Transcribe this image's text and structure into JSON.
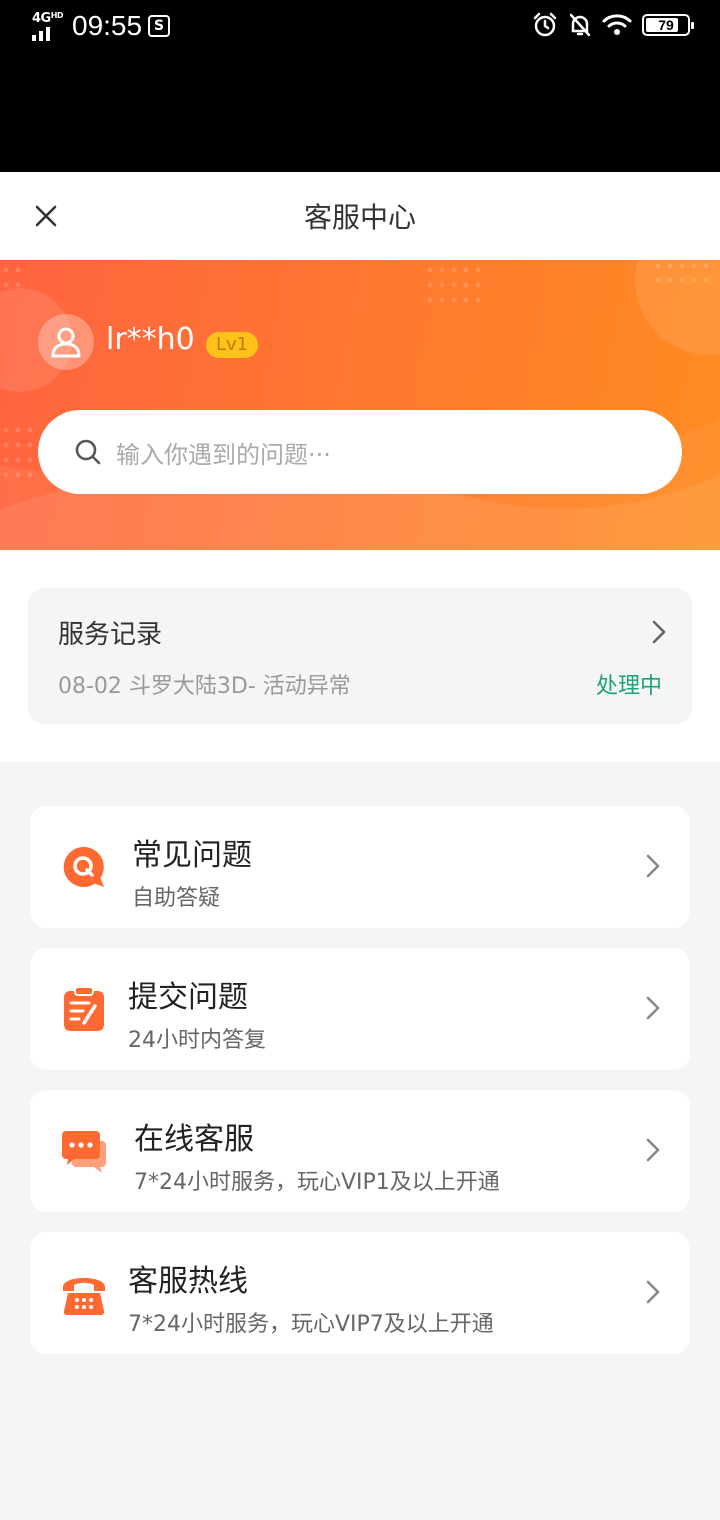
{
  "status_bar": {
    "network": "4G",
    "network_sup": "HD",
    "time": "09:55",
    "app_icon_glyph": "S",
    "battery": "79",
    "battery_level": 0.79
  },
  "nav": {
    "title": "客服中心",
    "close_icon": "close-icon"
  },
  "user": {
    "name": "lr**h0",
    "level": "Lv1"
  },
  "search": {
    "placeholder": "输入你遇到的问题···"
  },
  "record": {
    "title": "服务记录",
    "detail": "08-02 斗罗大陆3D- 活动异常",
    "status": "处理中"
  },
  "menu": [
    {
      "title": "常见问题",
      "subtitle": "自助答疑",
      "icon": "faq-icon"
    },
    {
      "title": "提交问题",
      "subtitle": "24小时内答复",
      "icon": "submit-icon"
    },
    {
      "title": "在线客服",
      "subtitle": "7*24小时服务，玩心VIP1及以上开通",
      "icon": "chat-icon"
    },
    {
      "title": "客服热线",
      "subtitle": "7*24小时服务，玩心VIP7及以上开通",
      "icon": "phone-icon"
    }
  ],
  "colors": {
    "accent": "#ff6a33",
    "status_green": "#1aa37a",
    "badge": "#ffc21a"
  }
}
